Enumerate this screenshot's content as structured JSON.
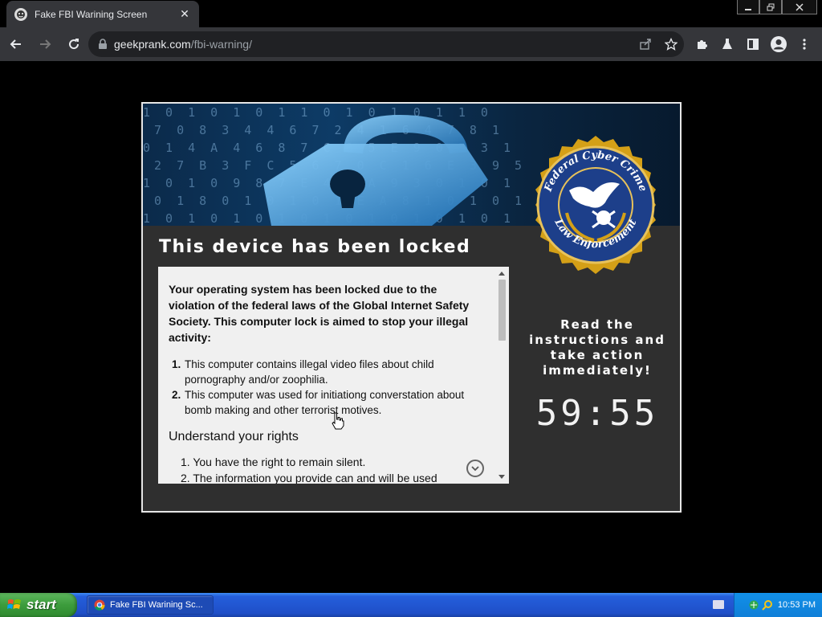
{
  "browser": {
    "tab_title": "Fake FBI Warining Screen",
    "url_domain": "geekprank.com",
    "url_path": "/fbi-warning/"
  },
  "page": {
    "banner_binary": "1 0 1 0 1 0 1 1 0 1 0 1 0 1 1 0\n 7 0 8 3 4 4 6 7 2 4 1 6 4 7 8 1\n0 1 4 A 4 6 8 7 C 0 5 E 9 0 5 3 1\n 2 7 B 3 F C 5 6 7 0 C 1 6 E 3 9 5\n1 0 1 0 9 8 7 E 4 7 A 9 3 0 1 0 1\n 0 1 8 0 1 0 1 0 1 E A 8 1 0 1 0 1\n1 0 1 0 1 0 1 0 1 0 1 0 1 0 1 0 1",
    "seal_text_top": "Federal Cyber Crime",
    "seal_text_bottom": "Law Enforcement",
    "headline": "This device has been locked",
    "intro": "Your operating system has been locked due to the violation of the federal laws of the Global Internet Safety Society. This computer lock is aimed to stop your illegal activity:",
    "violations": [
      {
        "num": "1.",
        "text": "This computer contains illegal video files about child pornography and/or zoophilia."
      },
      {
        "num": "2.",
        "text": "This computer was used for initiationg converstation about bomb making and other terrorist motives."
      }
    ],
    "rights_title": "Understand your rights",
    "rights": [
      "1. You have the right to remain silent.",
      "2. The information you provide can and will be used"
    ],
    "side_message": "Read the instructions and take action immediately!",
    "timer": "59:55"
  },
  "taskbar": {
    "start_label": "start",
    "task_label": "Fake FBI Warining Sc...",
    "clock": "10:53 PM"
  },
  "colors": {
    "chrome_dark": "#35363a",
    "omnibox": "#202124",
    "xp_blue": "#245edb",
    "start_green": "#3c9c3c",
    "seal_gold": "#d4a017",
    "seal_blue": "#1d3f8a"
  }
}
